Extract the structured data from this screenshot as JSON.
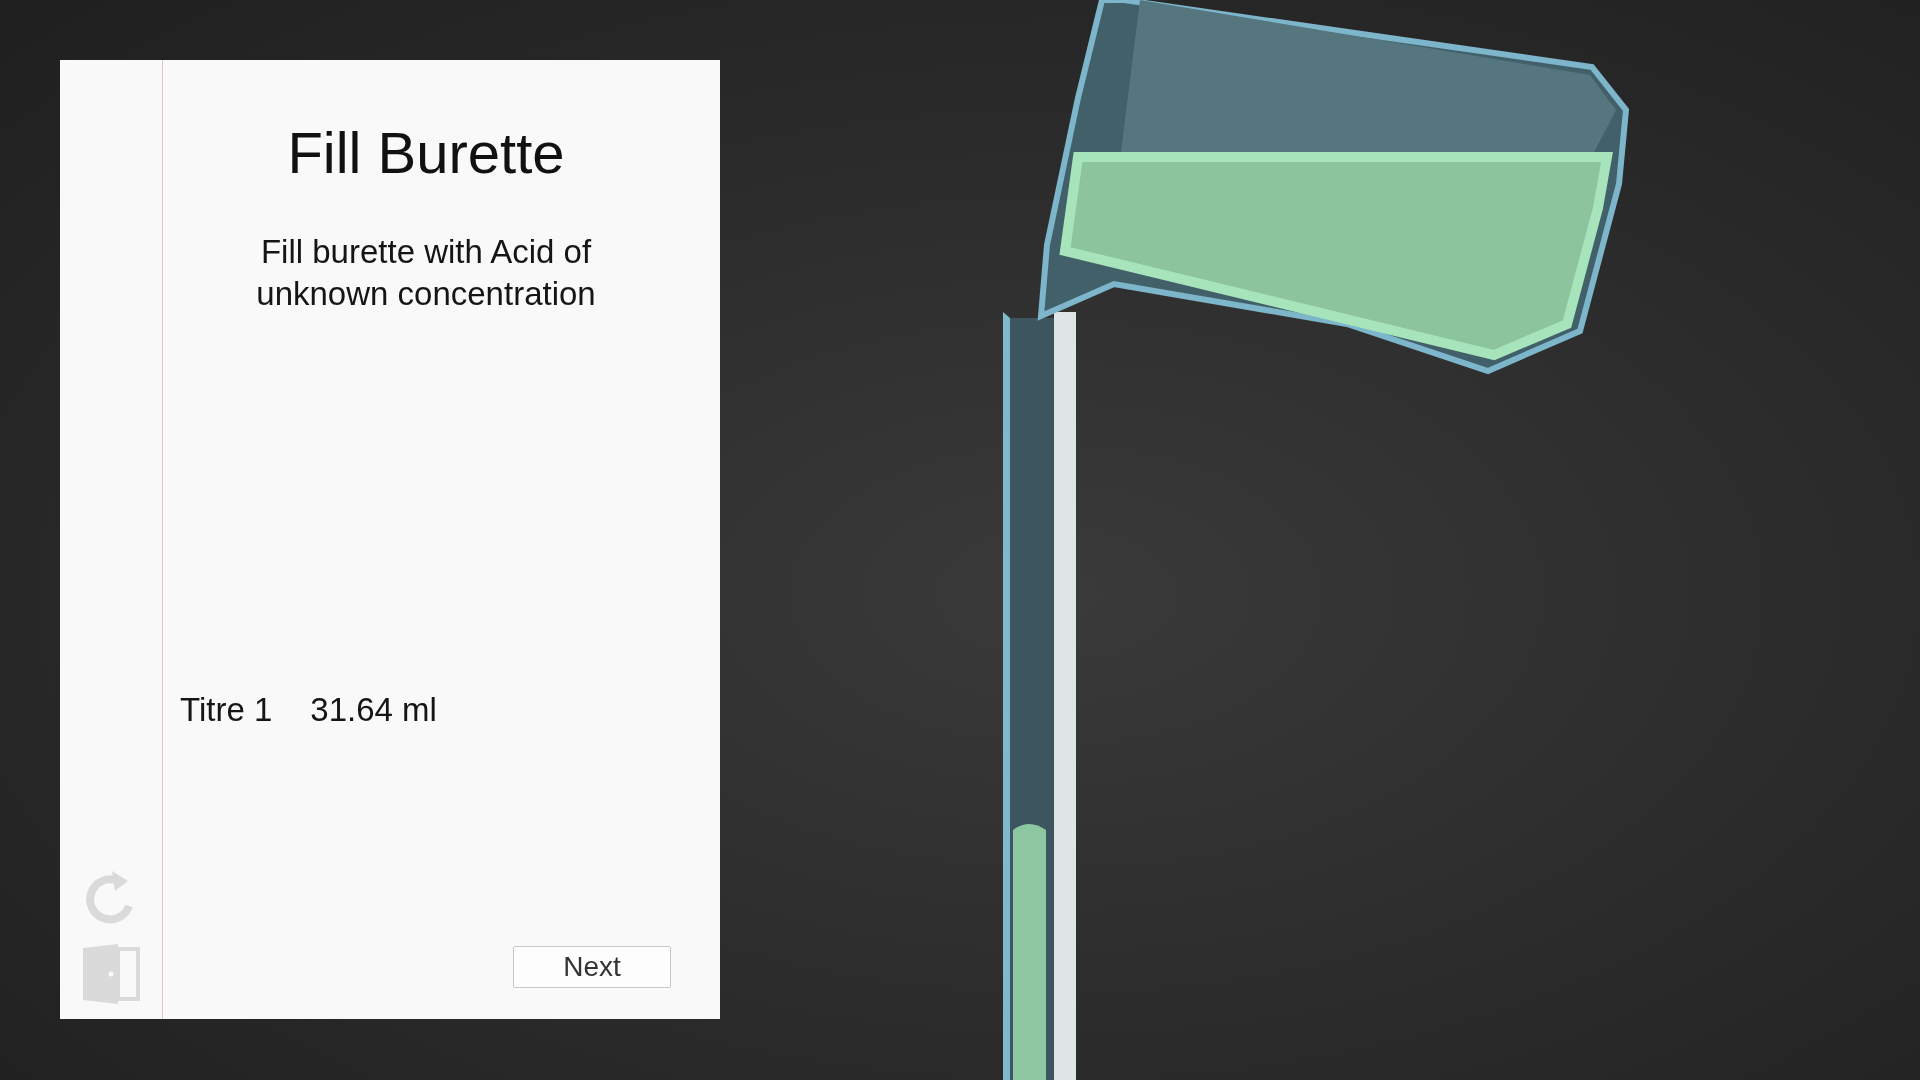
{
  "panel": {
    "title": "Fill Burette",
    "instruction": "Fill burette with Acid of unknown concentration",
    "titre": {
      "label": "Titre 1",
      "value": "31.64 ml"
    },
    "next_button": "Next"
  }
}
